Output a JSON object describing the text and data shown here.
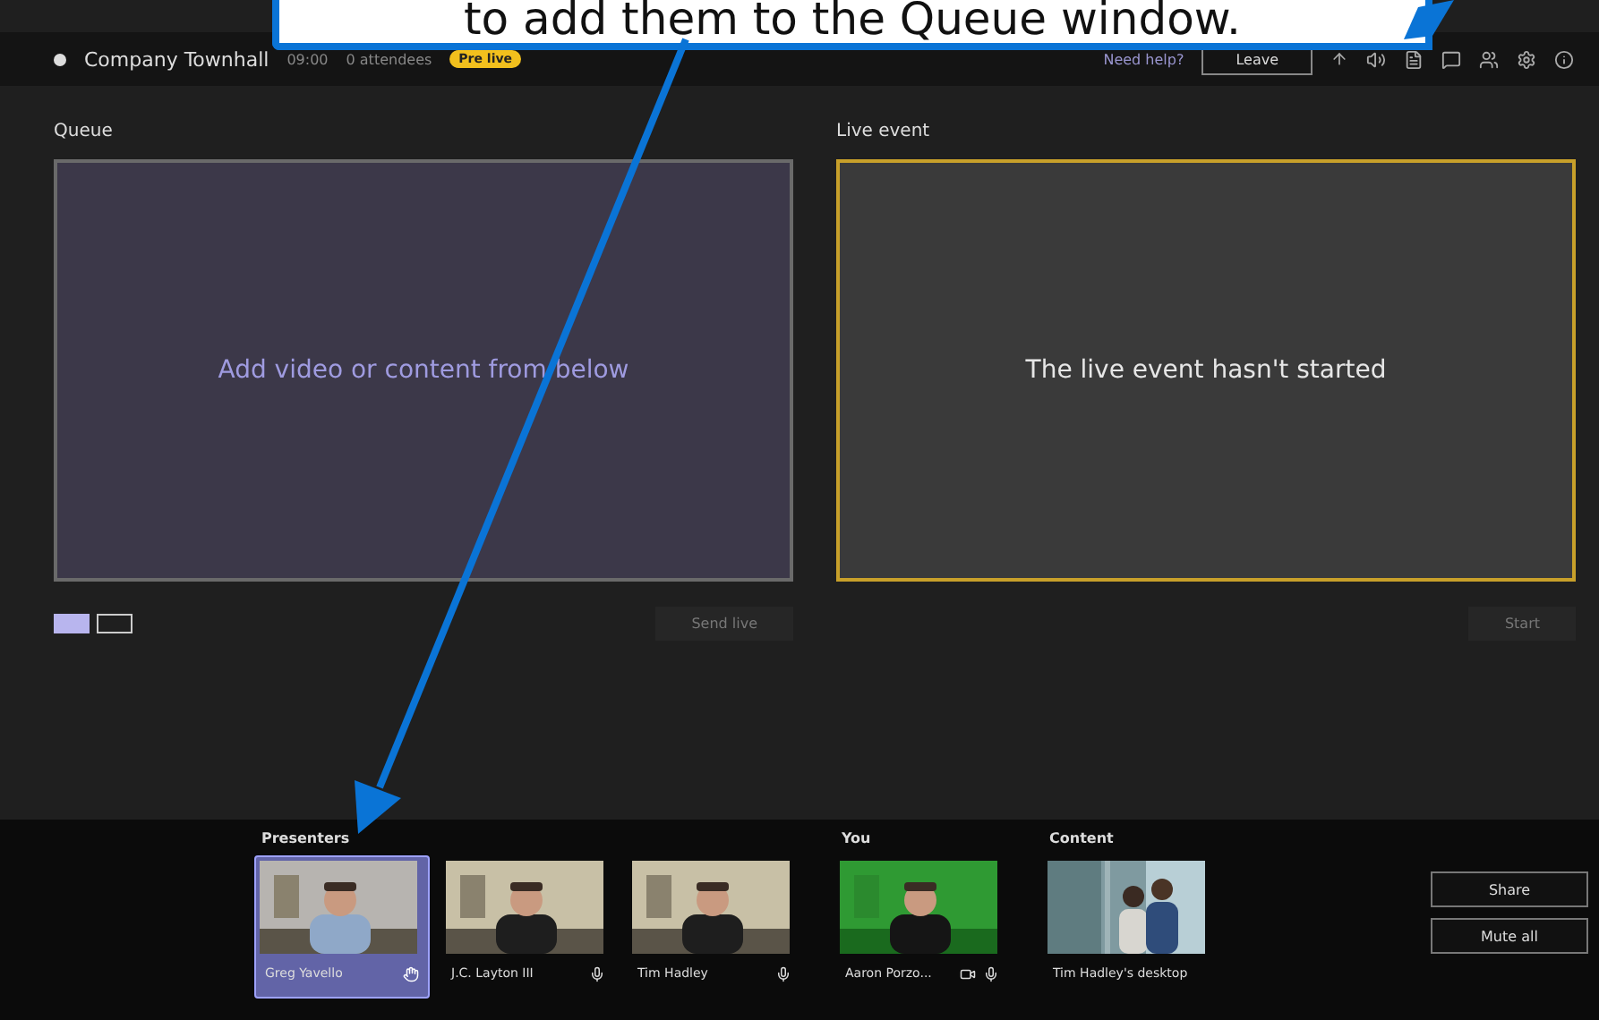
{
  "callout": {
    "text": "to add them to the Queue window."
  },
  "top_bar": {
    "title": "Company Townhall",
    "timer": "09:00",
    "attendees": "0 attendees",
    "badge": "Pre live",
    "help": "Need help?",
    "leave_button": "Leave"
  },
  "queue": {
    "title": "Queue",
    "message": "Add video or content from below",
    "send_button": "Send live",
    "layouts": [
      {
        "selected": true
      },
      {
        "selected": false
      }
    ]
  },
  "live_event": {
    "title": "Live event",
    "message": "The live event hasn't started",
    "start_button": "Start"
  },
  "presenters": {
    "title": "Presenters",
    "tiles": [
      {
        "name": "Greg Yavello",
        "selected": true,
        "kind": "hand"
      },
      {
        "name": "J.C. Layton III",
        "selected": false,
        "kind": "mic"
      },
      {
        "name": "Tim Hadley",
        "selected": false,
        "kind": "mic"
      }
    ]
  },
  "you": {
    "title": "You",
    "tiles": [
      {
        "name": "Aaron Porzo...",
        "selected": false,
        "kind": "camera-mic"
      }
    ]
  },
  "content": {
    "title": "Content",
    "tiles": [
      {
        "name": "Tim Hadley's desktop",
        "selected": false,
        "kind": "screen"
      }
    ]
  },
  "buttons": [
    "Share",
    "Mute all"
  ]
}
